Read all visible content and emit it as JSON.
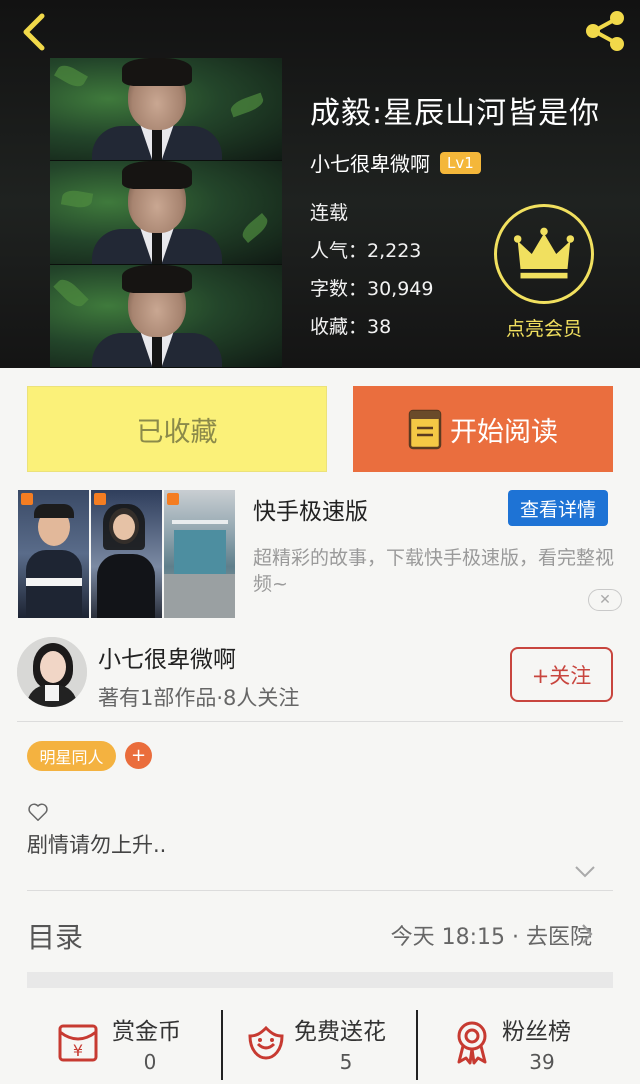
{
  "book": {
    "title": "成毅:星辰山河皆是你",
    "author": "小七很卑微啊",
    "level": "Lv1",
    "status": "连载",
    "popularity": "人气：2,223",
    "word_count": "字数：30,949",
    "collections": "收藏：38",
    "vip_label": "点亮会员"
  },
  "actions": {
    "favorited_label": "已收藏",
    "read_label": "开始阅读"
  },
  "ad": {
    "title": "快手极速版",
    "detail_button": "查看详情",
    "description": "超精彩的故事，下载快手极速版，看完整视频~",
    "close_symbol": "✕"
  },
  "author_card": {
    "name": "小七很卑微啊",
    "stats": "著有1部作品·8人关注",
    "follow_label": "+关注"
  },
  "tags": {
    "items": [
      "明星同人"
    ],
    "add_symbol": "+"
  },
  "synopsis": "剧情请勿上升..",
  "toc": {
    "label": "目录",
    "latest": "今天 18:15 · 去医院"
  },
  "bottom_bar": {
    "reward": {
      "label": "赏金币",
      "count": "0",
      "icon": "red-envelope-icon"
    },
    "flowers": {
      "label": "免费送花",
      "count": "5",
      "icon": "flower-icon"
    },
    "fans": {
      "label": "粉丝榜",
      "count": "39",
      "icon": "medal-icon"
    }
  },
  "colors": {
    "accent_orange": "#ea6e3e",
    "favorited_yellow": "#fbf179",
    "crown_yellow": "#f1e05f",
    "ad_blue": "#1e73d5",
    "follow_red": "#c8453e"
  }
}
